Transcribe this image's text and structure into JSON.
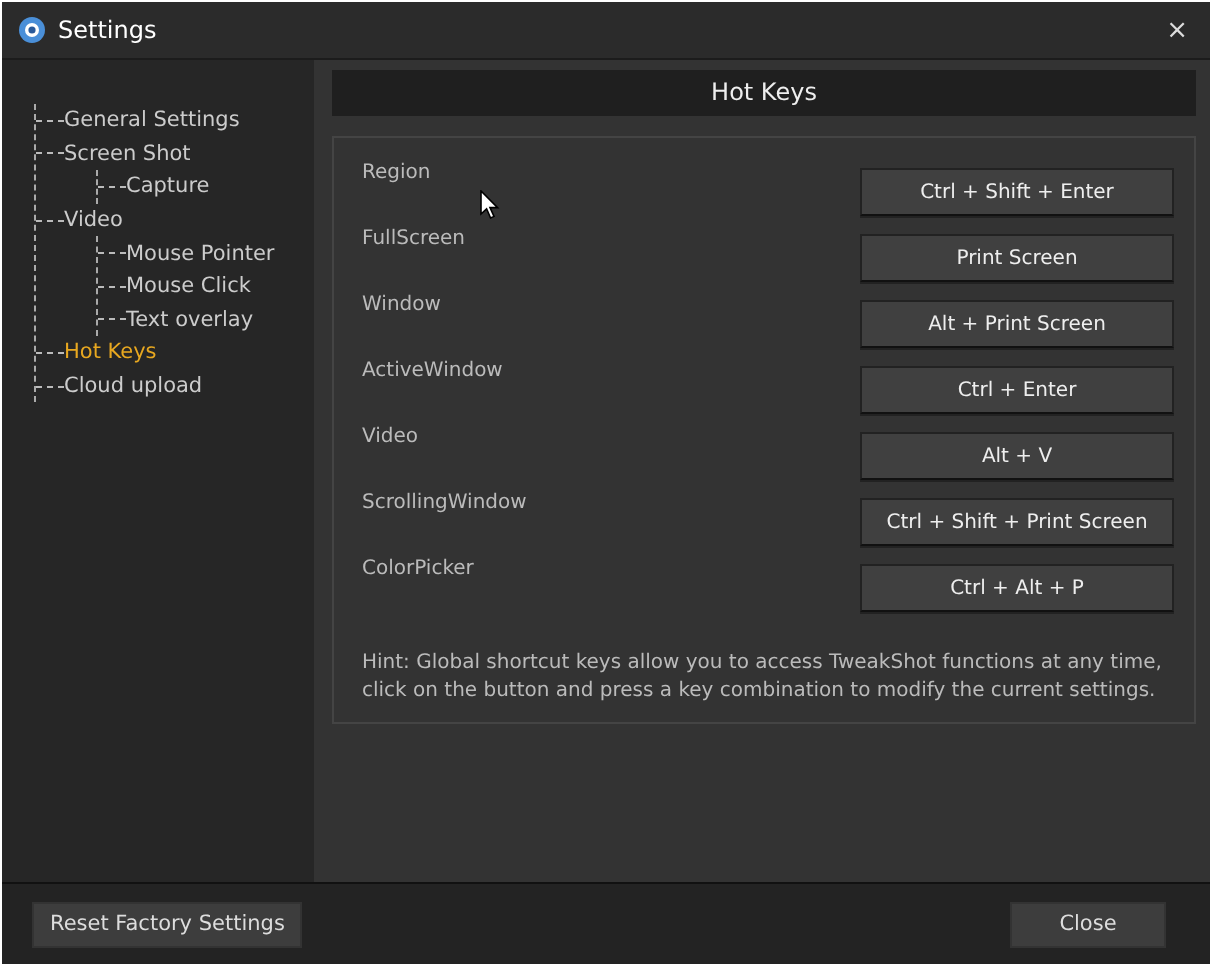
{
  "window": {
    "title": "Settings",
    "close": "×"
  },
  "sidebar": {
    "items": [
      {
        "label": "General Settings",
        "selected": false
      },
      {
        "label": "Screen Shot",
        "selected": false,
        "children": [
          {
            "label": "Capture",
            "selected": false
          }
        ]
      },
      {
        "label": "Video",
        "selected": false,
        "children": [
          {
            "label": "Mouse Pointer",
            "selected": false
          },
          {
            "label": "Mouse Click",
            "selected": false
          },
          {
            "label": "Text overlay",
            "selected": false
          }
        ]
      },
      {
        "label": "Hot Keys",
        "selected": true
      },
      {
        "label": "Cloud upload",
        "selected": false
      }
    ]
  },
  "panel": {
    "title": "Hot Keys",
    "hotkeys": [
      {
        "label": "Region",
        "keys": "Ctrl + Shift + Enter"
      },
      {
        "label": "FullScreen",
        "keys": "Print Screen"
      },
      {
        "label": "Window",
        "keys": "Alt + Print Screen"
      },
      {
        "label": "ActiveWindow",
        "keys": "Ctrl + Enter"
      },
      {
        "label": "Video",
        "keys": "Alt + V"
      },
      {
        "label": "ScrollingWindow",
        "keys": "Ctrl + Shift + Print Screen"
      },
      {
        "label": "ColorPicker",
        "keys": "Ctrl + Alt + P"
      }
    ],
    "hint": "Hint: Global shortcut keys allow you to access TweakShot functions at any time, click on the button and press a key combination to modify the current settings."
  },
  "footer": {
    "buttons": [
      "Reset Factory Settings",
      "Close"
    ]
  }
}
